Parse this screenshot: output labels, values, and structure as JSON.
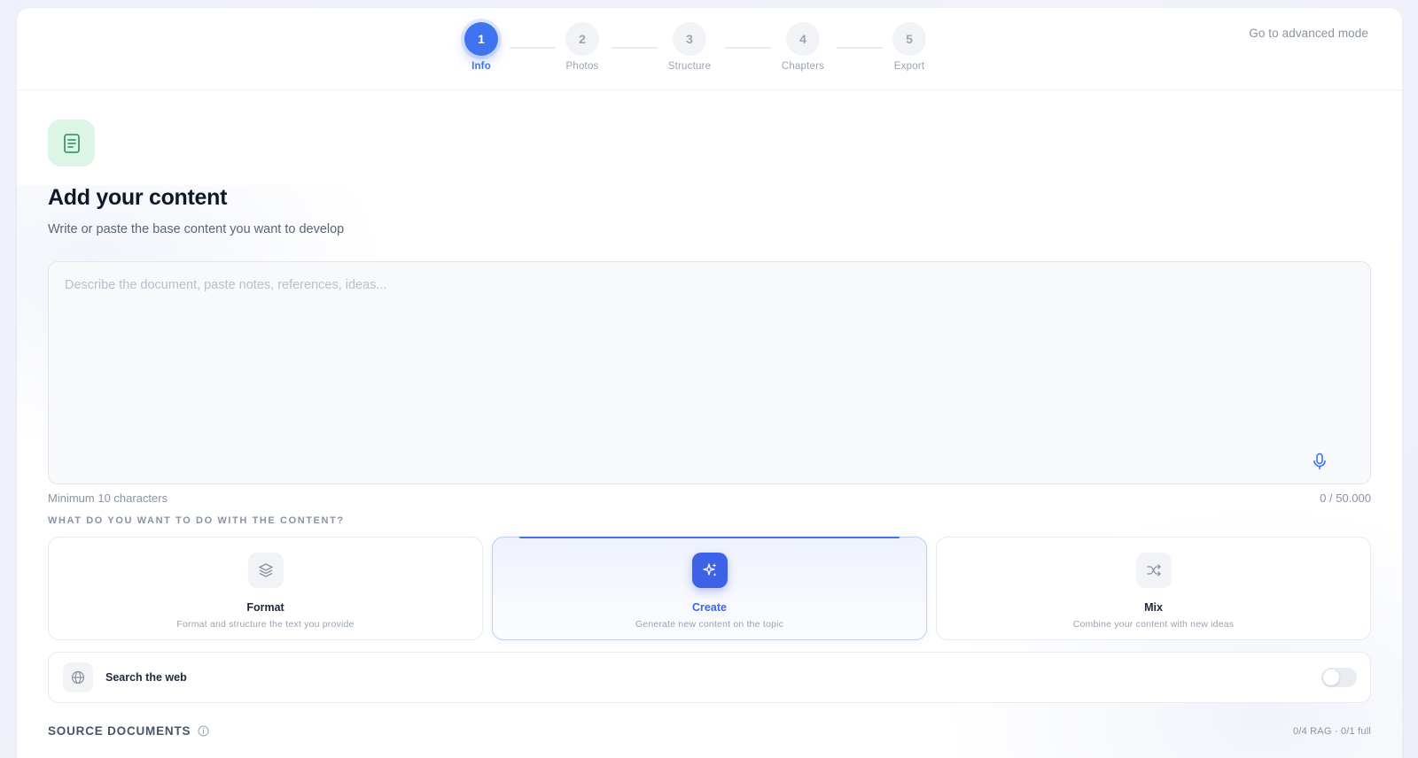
{
  "stepper": {
    "steps": [
      {
        "number": "1",
        "label": "Info",
        "active": true
      },
      {
        "number": "2",
        "label": "Photos",
        "active": false
      },
      {
        "number": "3",
        "label": "Structure",
        "active": false
      },
      {
        "number": "4",
        "label": "Chapters",
        "active": false
      },
      {
        "number": "5",
        "label": "Export",
        "active": false
      }
    ]
  },
  "header": {
    "advanced_link": "Go to advanced mode"
  },
  "main": {
    "icon": "document-icon",
    "title": "Add your content",
    "subtitle": "Write or paste the base content you want to develop",
    "textarea": {
      "value": "",
      "placeholder": "Describe the document, paste notes, references, ideas..."
    },
    "min_hint": "Minimum 10 characters",
    "char_count": "0 / 50.000"
  },
  "modes": {
    "section_label": "WHAT DO YOU WANT TO DO WITH THE CONTENT?",
    "items": [
      {
        "icon": "layers-icon",
        "title": "Format",
        "desc": "Format and structure the text you provide",
        "selected": false
      },
      {
        "icon": "sparkles-icon",
        "title": "Create",
        "desc": "Generate new content on the topic",
        "selected": true
      },
      {
        "icon": "shuffle-icon",
        "title": "Mix",
        "desc": "Combine your content with new ideas",
        "selected": false
      }
    ]
  },
  "web_search": {
    "icon": "globe-icon",
    "label": "Search the web",
    "enabled": false
  },
  "sources": {
    "title": "SOURCE DOCUMENTS",
    "count": "0/4 RAG · 0/1 full"
  },
  "colors": {
    "accent": "#3f73f0",
    "create_icon_bg": "#3d62e8",
    "hero_icon_bg": "#dcf5e6",
    "hero_icon_stroke": "#3f9a6a"
  }
}
